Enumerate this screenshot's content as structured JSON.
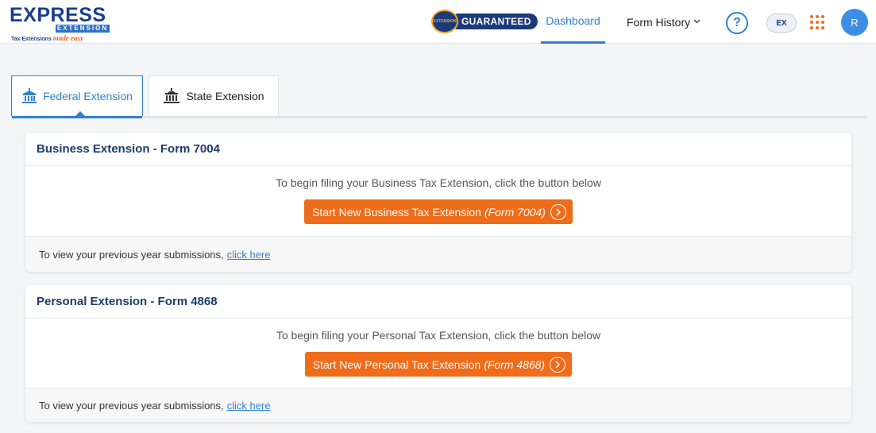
{
  "header": {
    "logo": {
      "brand": "EXPRESS",
      "sub_brand": "EXTENSION",
      "tagline": "Tax Extensions",
      "tagline_script": "made easy"
    },
    "badge": {
      "seal_text": "EXTENSION",
      "label": "GUARANTEED"
    },
    "nav": {
      "dashboard": "Dashboard",
      "form_history": "Form History"
    },
    "help_icon": "question-circle-icon",
    "ex_badge": "EX",
    "apps_icon": "apps-grid-icon",
    "avatar_initial": "R",
    "colors": {
      "accent": "#2f80d1",
      "orange": "#ef6c1a",
      "navy": "#1a3d8f"
    }
  },
  "tabs": [
    {
      "label": "Federal Extension",
      "icon": "federal-building-icon",
      "active": true
    },
    {
      "label": "State Extension",
      "icon": "state-building-icon",
      "active": false
    }
  ],
  "cards": [
    {
      "title": "Business Extension - Form 7004",
      "message": "To begin filing your Business Tax Extension, click the button below",
      "button_label": "Start New Business Tax Extension",
      "button_form": "(Form 7004)",
      "footer_text": "To view your previous year submissions,",
      "footer_link": "click here"
    },
    {
      "title": "Personal Extension - Form 4868",
      "message": "To begin filing your Personal Tax Extension, click the button below",
      "button_label": "Start New Personal Tax Extension",
      "button_form": "(Form 4868)",
      "footer_text": "To view your previous year submissions,",
      "footer_link": "click here"
    }
  ]
}
